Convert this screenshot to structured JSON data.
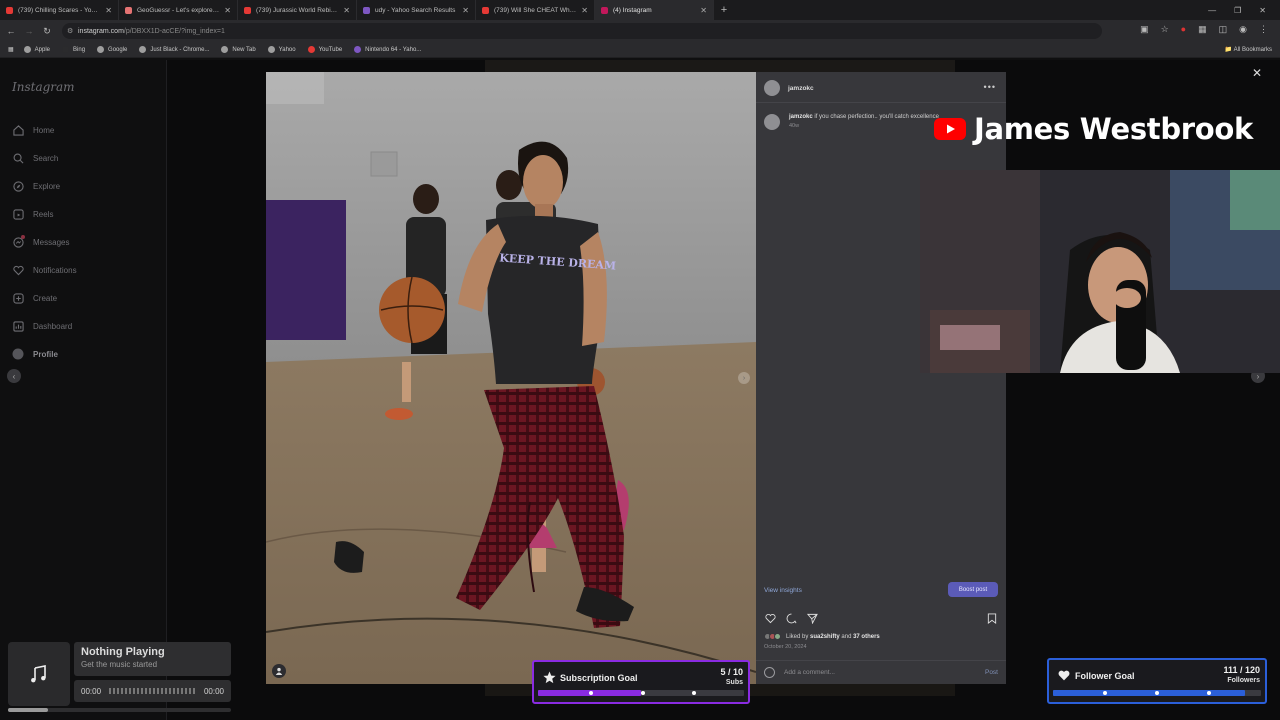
{
  "browser": {
    "tabs": [
      {
        "label": "(739) Chilling Scares - YouTube",
        "color": "#e53935"
      },
      {
        "label": "GeoGuessr - Let's explore the w",
        "color": "#e57373"
      },
      {
        "label": "(739) Jurassic World Rebirth | Th",
        "color": "#e53935"
      },
      {
        "label": "udy - Yahoo Search Results",
        "color": "#7e57c2"
      },
      {
        "label": "(739) Will She CHEAT While He",
        "color": "#e53935"
      },
      {
        "label": "(4) Instagram",
        "color": "#c2185b"
      }
    ],
    "url_host": "instagram.com",
    "url_path": "/p/DBXX1D-acCE/?img_index=1",
    "bookmarks": [
      {
        "label": "Apple",
        "color": "#9e9e9e"
      },
      {
        "label": "Bing",
        "color": "#2b2b2d"
      },
      {
        "label": "Google",
        "color": "#9e9e9e"
      },
      {
        "label": "Just Black - Chrome...",
        "color": "#9e9e9e"
      },
      {
        "label": "New Tab",
        "color": "#9e9e9e"
      },
      {
        "label": "Yahoo",
        "color": "#9e9e9e"
      },
      {
        "label": "YouTube",
        "color": "#e53935"
      },
      {
        "label": "Nintendo 64 - Yaho...",
        "color": "#7e57c2"
      }
    ],
    "all_bookmarks": "All Bookmarks"
  },
  "instagram": {
    "logo": "Instagram",
    "nav": [
      {
        "label": "Home",
        "icon": "home-icon"
      },
      {
        "label": "Search",
        "icon": "search-icon"
      },
      {
        "label": "Explore",
        "icon": "explore-icon"
      },
      {
        "label": "Reels",
        "icon": "reels-icon"
      },
      {
        "label": "Messages",
        "icon": "messages-icon"
      },
      {
        "label": "Notifications",
        "icon": "heart-icon"
      },
      {
        "label": "Create",
        "icon": "create-icon"
      },
      {
        "label": "Dashboard",
        "icon": "dashboard-icon"
      },
      {
        "label": "Profile",
        "icon": "avatar-icon"
      }
    ],
    "post": {
      "username": "jamzokc",
      "caption_user": "jamzokc",
      "caption": "if you chase perfection.. you'll catch excellence",
      "age": "40w",
      "view_insights": "View insights",
      "boost": "Boost post",
      "liked_prefix": "Liked by",
      "liked_user": "sua2shifty",
      "liked_and": "and",
      "liked_others": "37 others",
      "date": "October 20, 2024",
      "comment_placeholder": "Add a comment...",
      "post_label": "Post",
      "shirt_text": "KEEP THE DREAM"
    }
  },
  "stream": {
    "streamer_name": "James Westbrook",
    "music": {
      "title": "Nothing Playing",
      "subtitle": "Get the music started",
      "time_start": "00:00",
      "time_end": "00:00",
      "progress": 0.18
    },
    "sub_goal": {
      "title": "Subscription Goal",
      "count": "5 / 10",
      "unit": "Subs",
      "fraction": 0.5,
      "color": "#8a2be2"
    },
    "follower_goal": {
      "title": "Follower Goal",
      "count": "111 / 120",
      "unit": "Followers",
      "fraction": 0.925,
      "color": "#2b5fd9"
    }
  }
}
